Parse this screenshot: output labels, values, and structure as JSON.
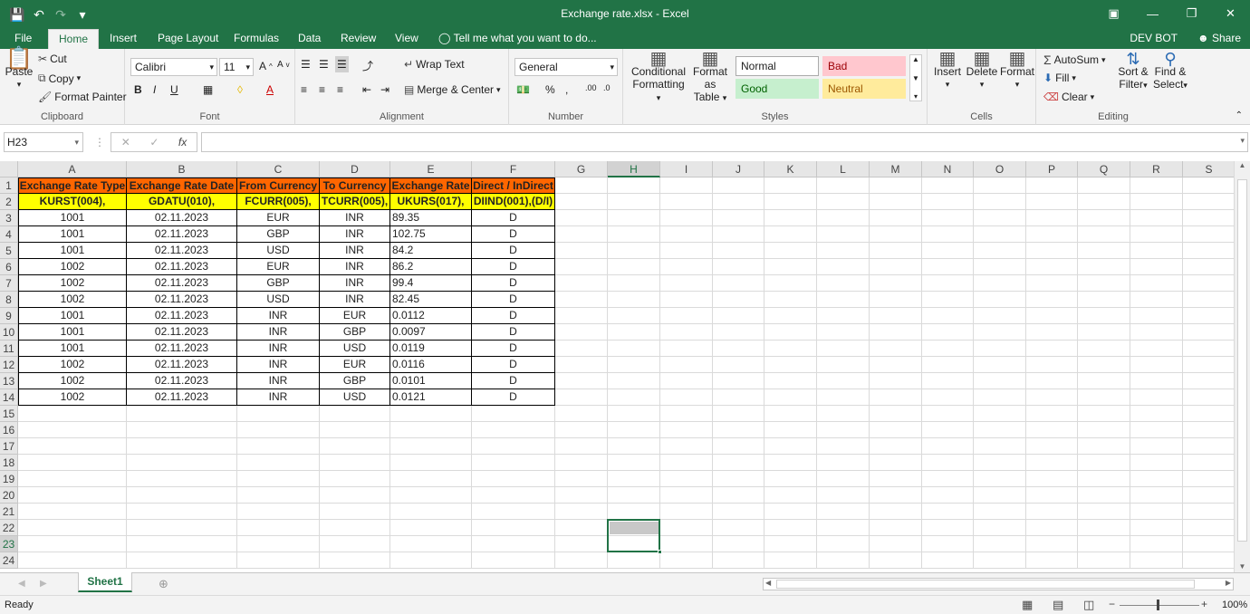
{
  "window": {
    "title": "Exchange rate.xlsx - Excel"
  },
  "tabs": [
    "File",
    "Home",
    "Insert",
    "Page Layout",
    "Formulas",
    "Data",
    "Review",
    "View"
  ],
  "active_tab": "Home",
  "tell_me": "Tell me what you want to do...",
  "user": "DEV BOT",
  "share": "Share",
  "ribbon": {
    "clipboard": {
      "paste": "Paste",
      "cut": "Cut",
      "copy": "Copy",
      "format_painter": "Format Painter",
      "label": "Clipboard"
    },
    "font": {
      "name": "Calibri",
      "size": "11",
      "label": "Font"
    },
    "alignment": {
      "wrap": "Wrap Text",
      "merge": "Merge & Center",
      "label": "Alignment"
    },
    "number": {
      "format": "General",
      "label": "Number"
    },
    "styles": {
      "conditional": "Conditional",
      "conditional2": "Formatting",
      "format_as": "Format as",
      "format_as2": "Table",
      "normal": "Normal",
      "bad": "Bad",
      "good": "Good",
      "neutral": "Neutral",
      "label": "Styles"
    },
    "cells": {
      "insert": "Insert",
      "delete": "Delete",
      "format": "Format",
      "label": "Cells"
    },
    "editing": {
      "autosum": "AutoSum",
      "fill": "Fill",
      "clear": "Clear",
      "sort": "Sort &",
      "sort2": "Filter",
      "find": "Find &",
      "find2": "Select",
      "label": "Editing"
    }
  },
  "formula_bar": {
    "name_box": "H23",
    "formula": ""
  },
  "columns": [
    "A",
    "B",
    "C",
    "D",
    "E",
    "F",
    "G",
    "H",
    "I",
    "J",
    "K",
    "L",
    "M",
    "N",
    "O",
    "P",
    "Q",
    "R",
    "S"
  ],
  "rows": [
    "1",
    "2",
    "3",
    "4",
    "5",
    "6",
    "7",
    "8",
    "9",
    "10",
    "11",
    "12",
    "13",
    "14",
    "15",
    "16",
    "17",
    "18",
    "19",
    "20",
    "21",
    "22",
    "23",
    "24"
  ],
  "header_row": [
    "Exchange Rate Type",
    "Exchange Rate Date",
    "From Currency",
    "To Currency",
    "Exchange Rate",
    "Direct / InDirect"
  ],
  "field_row": [
    "KURST(004),",
    "GDATU(010),",
    "FCURR(005),",
    "TCURR(005),",
    "UKURS(017),",
    "DIIND(001),(D/I)"
  ],
  "data_rows": [
    [
      "1001",
      "02.11.2023",
      "EUR",
      "INR",
      "89.35",
      "D"
    ],
    [
      "1001",
      "02.11.2023",
      "GBP",
      "INR",
      "102.75",
      "D"
    ],
    [
      "1001",
      "02.11.2023",
      "USD",
      "INR",
      "84.2",
      "D"
    ],
    [
      "1002",
      "02.11.2023",
      "EUR",
      "INR",
      "86.2",
      "D"
    ],
    [
      "1002",
      "02.11.2023",
      "GBP",
      "INR",
      "99.4",
      "D"
    ],
    [
      "1002",
      "02.11.2023",
      "USD",
      "INR",
      "82.45",
      "D"
    ],
    [
      "1001",
      "02.11.2023",
      "INR",
      "EUR",
      "0.0112",
      "D"
    ],
    [
      "1001",
      "02.11.2023",
      "INR",
      "GBP",
      "0.0097",
      "D"
    ],
    [
      "1001",
      "02.11.2023",
      "INR",
      "USD",
      "0.0119",
      "D"
    ],
    [
      "1002",
      "02.11.2023",
      "INR",
      "EUR",
      "0.0116",
      "D"
    ],
    [
      "1002",
      "02.11.2023",
      "INR",
      "GBP",
      "0.0101",
      "D"
    ],
    [
      "1002",
      "02.11.2023",
      "INR",
      "USD",
      "0.0121",
      "D"
    ]
  ],
  "sheet_tab": "Sheet1",
  "status": {
    "ready": "Ready",
    "zoom": "100%"
  },
  "colors": {
    "excel_green": "#217346",
    "header_fill": "#ff6600",
    "field_fill": "#ffff00"
  }
}
